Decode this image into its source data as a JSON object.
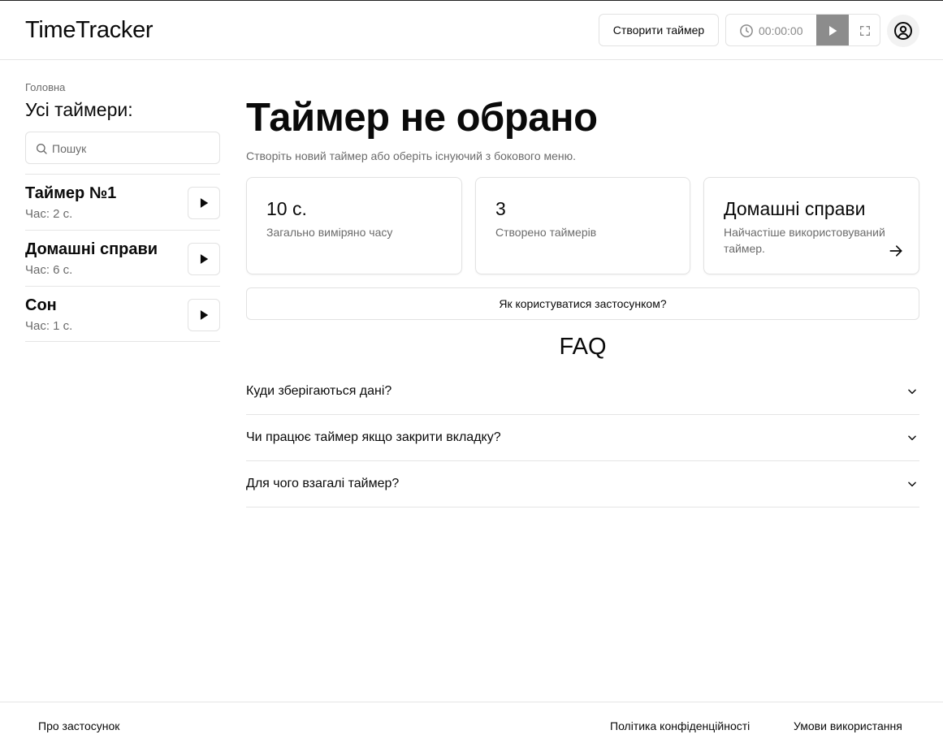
{
  "header": {
    "logo": "TimeTracker",
    "create_button": "Створити таймер",
    "timer_display": "00:00:00"
  },
  "sidebar": {
    "breadcrumb": "Головна",
    "title": "Усі таймери:",
    "search_placeholder": "Пошук",
    "timers": [
      {
        "name": "Таймер №1",
        "time": "Час: 2 с."
      },
      {
        "name": "Домашні справи",
        "time": "Час: 6 с."
      },
      {
        "name": "Сон",
        "time": "Час: 1 с."
      }
    ]
  },
  "main": {
    "title": "Таймер не обрано",
    "subtitle": "Створіть новий таймер або оберіть існуючий з бокового меню.",
    "stats": [
      {
        "value": "10 с.",
        "label": "Загально виміряно часу"
      },
      {
        "value": "3",
        "label": "Створено таймерів"
      },
      {
        "value": "Домашні справи",
        "label": "Найчастіше використовуваний таймер."
      }
    ],
    "help_button": "Як користуватися застосунком?",
    "faq_title": "FAQ",
    "faq": [
      "Куди зберігаються дані?",
      "Чи працює таймер якщо закрити вкладку?",
      "Для чого взагалі таймер?"
    ]
  },
  "footer": {
    "about": "Про застосунок",
    "privacy": "Політика конфіденційності",
    "terms": "Умови використання"
  },
  "icons": {
    "clock": "clock-icon",
    "play": "play-icon",
    "fullscreen": "fullscreen-icon",
    "user": "user-circle-icon",
    "search": "search-icon",
    "arrow": "arrow-right-icon",
    "chevron": "chevron-down-icon"
  }
}
